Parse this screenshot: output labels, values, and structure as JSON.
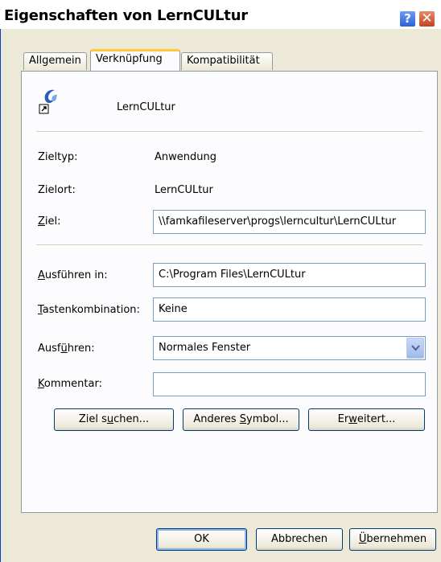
{
  "window": {
    "title": "Eigenschaften von LernCULtur",
    "help_label": "?",
    "close_label": "✕"
  },
  "tabs": [
    {
      "label": "Allgemein",
      "active": false
    },
    {
      "label": "Verknüpfung",
      "active": true
    },
    {
      "label": "Kompatibilität",
      "active": false
    }
  ],
  "shortcut": {
    "name": "LernCULtur",
    "zieltyp_label": "Zieltyp:",
    "zieltyp_value": "Anwendung",
    "zielort_label": "Zielort:",
    "zielort_value": "LernCULtur",
    "ziel_label_pre": "",
    "ziel_label_u": "Z",
    "ziel_label_post": "iel:",
    "ziel_value": "\\\\famkafileserver\\progs\\lerncultur\\LernCULtur",
    "ausfuehren_in_u": "A",
    "ausfuehren_in_post": "usführen in:",
    "ausfuehren_in_value": "C:\\Program Files\\LernCULtur",
    "tasten_u": "T",
    "tasten_post": "astenkombination:",
    "tasten_value": "Keine",
    "ausfuehren_pre": "Ausf",
    "ausfuehren_u": "ü",
    "ausfuehren_post": "hren:",
    "ausfuehren_value": "Normales Fenster",
    "kommentar_u": "K",
    "kommentar_post": "ommentar:",
    "kommentar_value": ""
  },
  "buttons": {
    "ziel_suchen_pre": "Ziel s",
    "ziel_suchen_u": "u",
    "ziel_suchen_post": "chen...",
    "anderes_pre": "Anderes ",
    "anderes_u": "S",
    "anderes_post": "ymbol...",
    "erweitert_pre": "Er",
    "erweitert_u": "w",
    "erweitert_post": "eitert...",
    "ok": "OK",
    "abbrechen": "Abbrechen",
    "uebernehmen_u": "Ü",
    "uebernehmen_post": "bernehmen"
  },
  "colors": {
    "titlebar_text": "#000000",
    "active_tab_accent": "#ffc83c",
    "dialog_bg": "#ece9d8"
  }
}
